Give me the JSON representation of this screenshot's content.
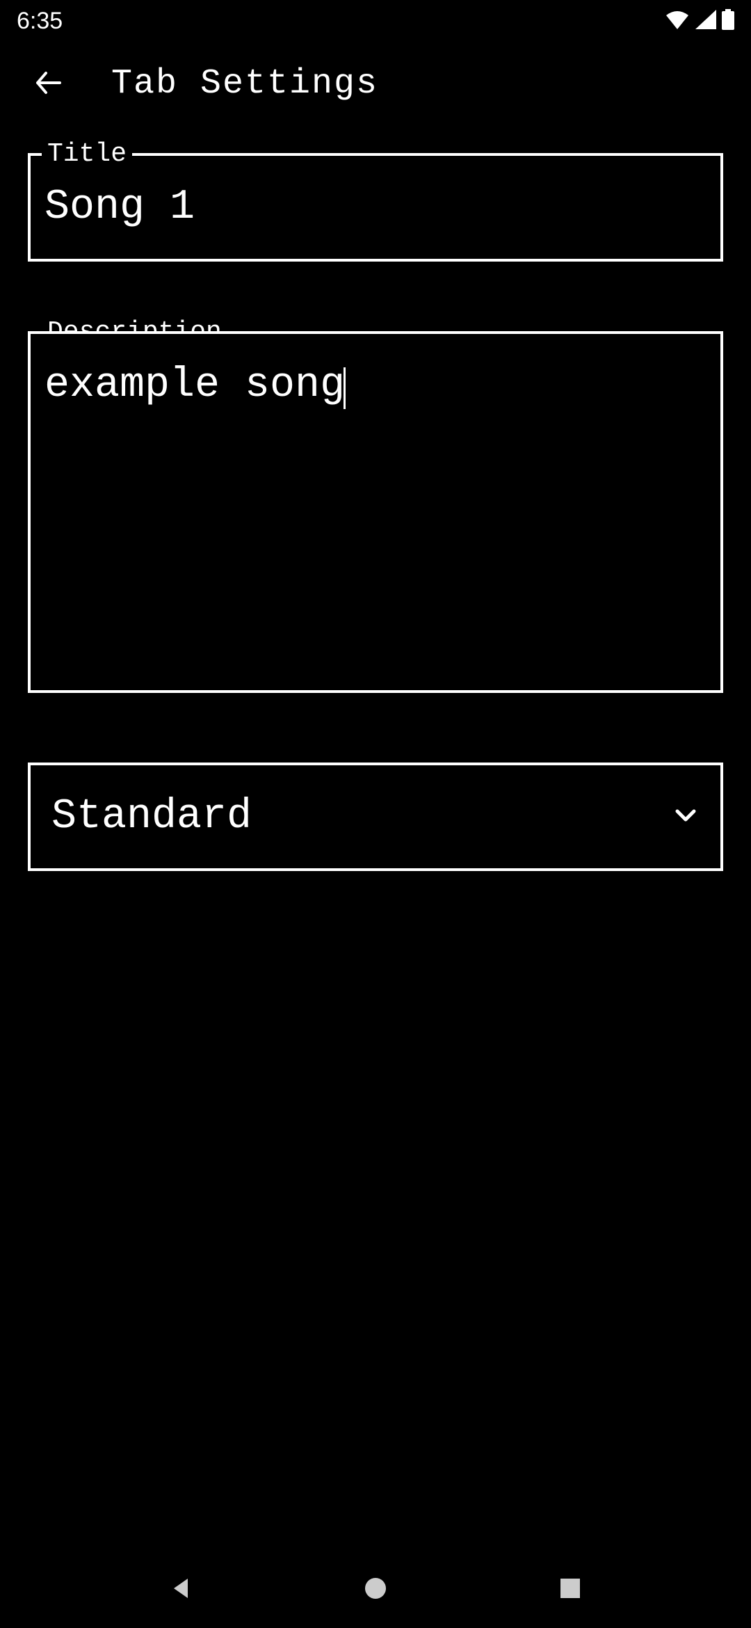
{
  "status": {
    "time": "6:35"
  },
  "header": {
    "title": "Tab Settings"
  },
  "form": {
    "title_label": "Title",
    "title_value": "Song 1",
    "description_label": "Description",
    "description_value": "example song",
    "dropdown_value": "Standard"
  }
}
